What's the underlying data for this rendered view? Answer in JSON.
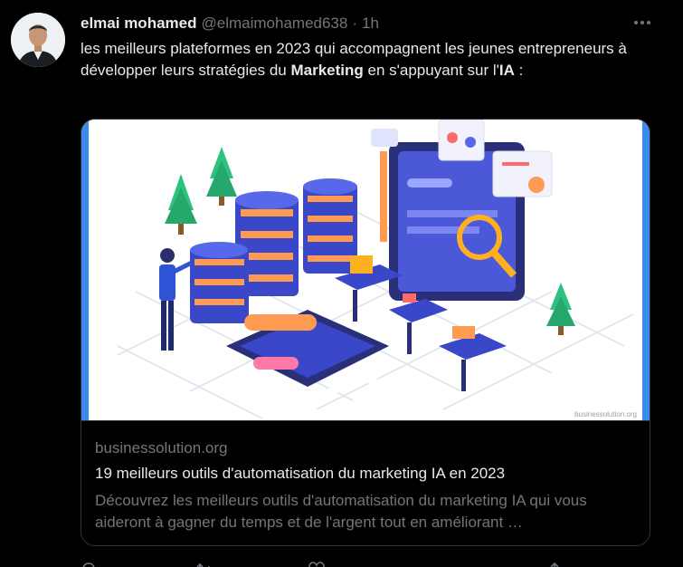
{
  "author": {
    "display_name": "elmai mohamed",
    "handle": "@elmaimohamed638",
    "separator": "·",
    "time": "1h"
  },
  "tweet": {
    "part1": "les meilleurs plateformes en 2023 qui accompagnent les jeunes entrepreneurs à développer leurs stratégies du ",
    "bold1": "Marketing",
    "part2": " en s'appuyant sur l'",
    "bold2": "IA",
    "part3": " :"
  },
  "card": {
    "image_caption": "businessolution.org",
    "domain": "businessolution.org",
    "title": "19 meilleurs outils d'automatisation du marketing IA en 2023",
    "description": "Découvrez les meilleurs outils d'automatisation du marketing IA qui vous aideront à gagner du temps et de l'argent tout en améliorant …"
  },
  "icons": {
    "more": "more-icon",
    "reply": "reply-icon",
    "repost": "repost-icon",
    "like": "like-icon",
    "share": "share-icon"
  },
  "colors": {
    "background": "#000000",
    "text": "#e7e9ea",
    "secondary": "#71767b",
    "border": "#2f3336"
  }
}
